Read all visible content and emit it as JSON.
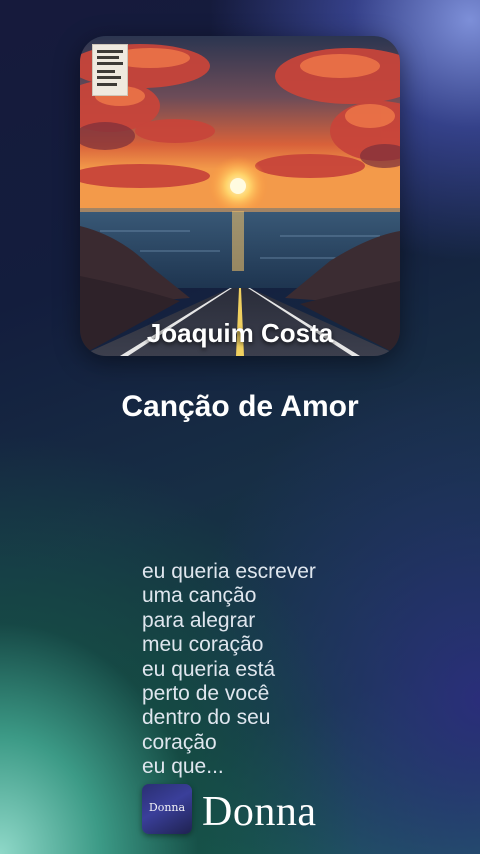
{
  "album": {
    "artist": "Joaquim Costa"
  },
  "song": {
    "title": "Canção de Amor"
  },
  "lyrics": [
    "eu queria escrever",
    "uma canção",
    "para alegrar",
    "meu coração",
    "eu queria está",
    "perto de você",
    "dentro do seu",
    "coração",
    "eu que..."
  ],
  "brand": {
    "logo_text": "Donna",
    "name": "Donna"
  }
}
